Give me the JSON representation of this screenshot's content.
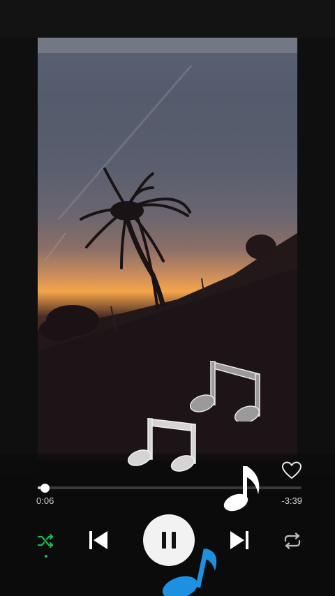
{
  "player": {
    "elapsed": "0:06",
    "remaining": "-3:39",
    "progress": 0.027,
    "is_playing": true,
    "shuffle_enabled": true
  },
  "colors": {
    "accent_green": "#1db954",
    "note_blue": "#1e90e0",
    "note_gray": "#9a9a9a",
    "note_light": "#d4d4d4"
  },
  "icons": {
    "like": "heart-outline-icon",
    "shuffle": "shuffle-icon",
    "previous": "skip-previous-icon",
    "pause": "pause-icon",
    "next": "skip-next-icon",
    "repeat": "repeat-icon",
    "decor": "music-note-icon"
  }
}
